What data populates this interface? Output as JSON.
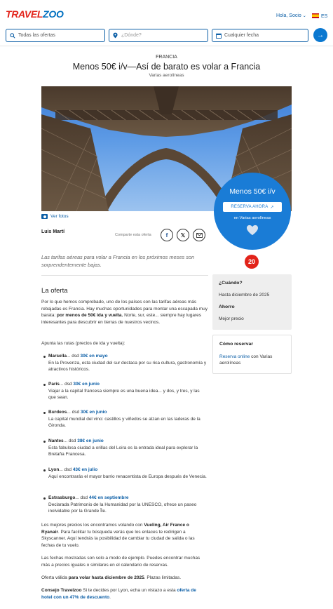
{
  "header": {
    "logo_left": "TRAVEL",
    "logo_right": "ZOO",
    "greeting": "Hola, Socio",
    "language": "ES",
    "search": {
      "offers_placeholder": "Todas las ofertas",
      "where_placeholder": "¿Dónde?",
      "date_placeholder": "Cualquier fecha"
    }
  },
  "deal": {
    "kicker": "FRANCIA",
    "title": "Menos 50€ i/v—Así de barato es volar a Francia",
    "subtitle": "Varias aerolíneas",
    "ver_fotos": "Ver fotos",
    "price": "Menos 50€ i/v",
    "reserve_label": "RESERVA AHORA",
    "en": "en Varias aerolíneas",
    "author": "Luis Martí",
    "share_label": "Comparte esta oferta",
    "lead": "Las tarifas aéreas para volar a Francia en los próximos meses son sorprendentemente bajas.",
    "badge": "20"
  },
  "article": {
    "heading": "La oferta",
    "intro_a": "Por lo que hemos comprobado, uno de los países con las tarifas aéreas más rebajadas es Francia. Hay muchas oportunidades para montar una escapada muy barata: ",
    "intro_bold": "por menos de 50€ ida y vuelta.",
    "intro_b": " Norte, sur, este... siempre hay lugares interesantes para descubrir en tierras de nuestros vecinos.",
    "routes_intro": "Apunta las rutas (precios de ida y vuelta):",
    "routes": [
      {
        "city": "Marsella",
        "sep": "... dsd ",
        "price": "30€ en mayo",
        "desc": "En la Provenza, esta ciudad del sur destaca por su rica cultura, gastronomía y atractivos históricos."
      },
      {
        "city": "París",
        "sep": "... dsd ",
        "price": "30€ en junio",
        "desc": "Viajar a la capital francesa siempre es una buena idea... y dos, y tres, y las que sean."
      },
      {
        "city": "Burdeos",
        "sep": "... dsd ",
        "price": "30€ en junio",
        "desc": "La capital mundial del vino: castillos y viñedos se alzan en las laderas de la Gironda."
      },
      {
        "city": "Nantes",
        "sep": "... dsd ",
        "price": "38€ en junio",
        "desc": "Esta fabulosa ciudad a orillas del Loira es la entrada ideal para explorar la Bretaña Francesa."
      },
      {
        "city": "Lyon",
        "sep": "... dsd ",
        "price": "43€ en julio",
        "desc": "Aquí encontrarás el mayor barrio renacentista de Europa después de Venecia."
      },
      {
        "city": "Estrasburgo",
        "sep": "... dsd ",
        "price": "44€ en septiembre",
        "desc": "Declarada Patrimonio de la Humanidad por la UNESCO, ofrece un paseo inolvidable por la Grande Île."
      }
    ],
    "airlines_a": "Los mejores precios los encontramos volando con ",
    "airlines_bold": "Vueling, Air France o Ryanair",
    "airlines_b": ". Para facilitar tu búsqueda verás que los enlaces te redirigen a Skyscanner. Aquí tendrás la posibilidad de cambiar tu ciudad de salida o las fechas de tu vuelo.",
    "dates": "Las fechas mostradas son solo a modo de ejemplo. Puedes encontrar muchas más a precios iguales o similares en el calendario de reservas.",
    "valid_a": "Oferta válida ",
    "valid_bold": "para volar hasta diciembre de 2025",
    "valid_b": ". Plazas limitadas.",
    "tip_bold": "Consejo Travelzoo",
    "tip_a": " Si te decides por Lyon, echa un vistazo a esta ",
    "tip_link": "oferta de hotel con un 47% de descuento",
    "tip_b": "."
  },
  "sidebar": {
    "when_h": "¿Cuándo?",
    "when_t": "Hasta diciembre de 2025",
    "save_h": "Ahorro",
    "save_t": "Mejor precio",
    "how_h": "Cómo reservar",
    "how_link": "Reserva online",
    "how_t": " con Varias aerolíneas"
  }
}
